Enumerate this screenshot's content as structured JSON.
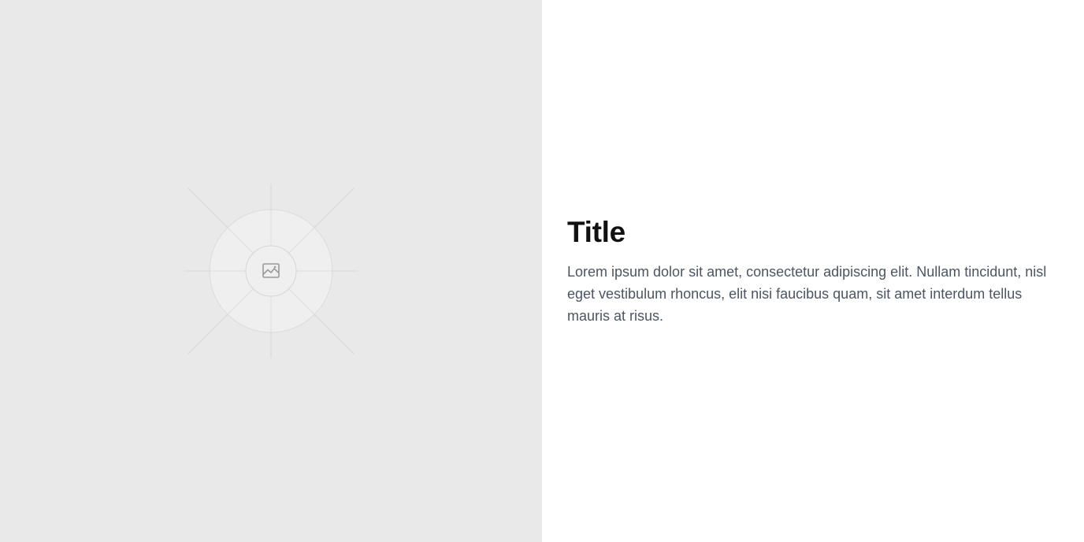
{
  "media": {
    "icon": "image-icon",
    "background_color": "#e9e9e9"
  },
  "content": {
    "title": "Title",
    "description": "Lorem ipsum dolor sit amet, consectetur adipiscing elit. Nullam tincidunt, nisl eget vestibulum rhoncus, elit nisi faucibus quam, sit amet interdum tellus mauris at risus."
  }
}
